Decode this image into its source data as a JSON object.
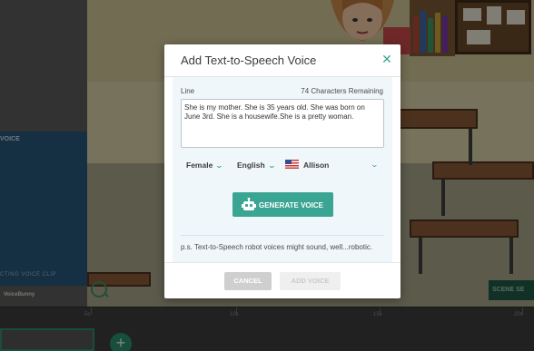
{
  "modal": {
    "title": "Add Text-to-Speech Voice",
    "close_icon": "close-icon",
    "line_label": "Line",
    "chars_remaining": "74 Characters Remaining",
    "line_text": "She is my mother. She is 35 years old. She was born on June 3rd. She is a housewife.She is a pretty woman.",
    "gender": "Female",
    "language": "English",
    "voice": "Allison",
    "voice_flag": "us-flag-icon",
    "generate_icon": "robot-icon",
    "generate_label": "GENERATE VOICE",
    "note": "p.s. Text-to-Speech robot voices might sound, well...robotic.",
    "cancel_label": "CANCEL",
    "add_label": "ADD VOICE"
  },
  "background": {
    "panel_label": "VOICE",
    "panel_bottom_label": "CTING VOICE CLIP",
    "logo_text": "VoiceBunny",
    "scene_button": "SCENE SE",
    "add_clip_icon": "plus-icon",
    "zoom_icon": "zoom-in-icon",
    "timeline_ticks": [
      "5s",
      "10s",
      "15s",
      "20s"
    ]
  },
  "colors": {
    "accent": "#3aa592",
    "body_bg": "#f0f7fb",
    "overlay": "rgba(0,0,0,0.45)"
  }
}
